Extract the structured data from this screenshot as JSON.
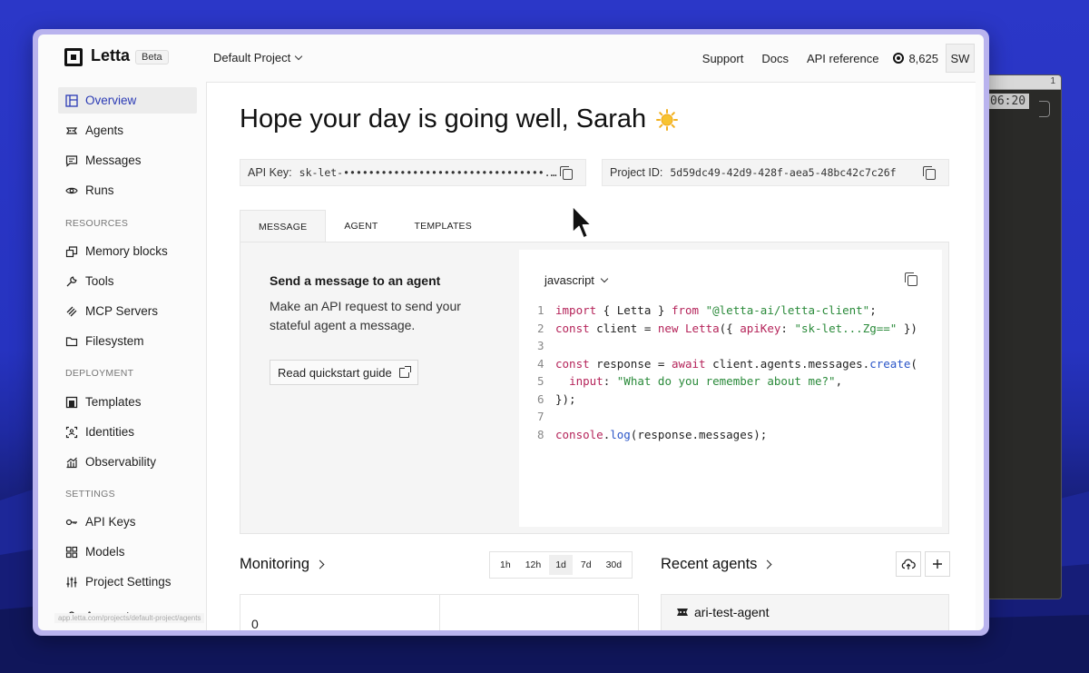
{
  "terminal": {
    "time": "06:20",
    "tab_num": "1"
  },
  "header": {
    "brand": "Letta",
    "badge": "Beta",
    "project": "Default Project",
    "links": [
      "Support",
      "Docs",
      "API reference"
    ],
    "credits": "8,625",
    "avatar": "SW"
  },
  "sidebar": {
    "items": [
      {
        "label": "Overview",
        "icon": "layout-icon",
        "active": true
      },
      {
        "label": "Agents",
        "icon": "agent-icon"
      },
      {
        "label": "Messages",
        "icon": "message-icon"
      },
      {
        "label": "Runs",
        "icon": "eye-icon"
      }
    ],
    "resources_label": "RESOURCES",
    "resources": [
      {
        "label": "Memory blocks",
        "icon": "blocks-icon"
      },
      {
        "label": "Tools",
        "icon": "wrench-icon"
      },
      {
        "label": "MCP Servers",
        "icon": "mcp-icon"
      },
      {
        "label": "Filesystem",
        "icon": "folder-icon"
      }
    ],
    "deployment_label": "DEPLOYMENT",
    "deployment": [
      {
        "label": "Templates",
        "icon": "template-icon"
      },
      {
        "label": "Identities",
        "icon": "identity-icon"
      },
      {
        "label": "Observability",
        "icon": "chart-icon"
      }
    ],
    "settings_label": "SETTINGS",
    "settings": [
      {
        "label": "API Keys",
        "icon": "key-icon"
      },
      {
        "label": "Models",
        "icon": "grid-icon"
      },
      {
        "label": "Project Settings",
        "icon": "sliders-icon"
      },
      {
        "label": "Account",
        "icon": "user-icon"
      }
    ],
    "status_url": "app.letta.com/projects/default-project/agents"
  },
  "main": {
    "greeting": "Hope your day is going well, Sarah",
    "api_key_label": "API Key:",
    "api_key_value": "sk-let-••••••••••••••••••••••••••••••••...",
    "project_id_label": "Project ID:",
    "project_id_value": "5d59dc49-42d9-428f-aea5-48bc42c7c26f",
    "tabs": [
      "MESSAGE",
      "AGENT",
      "TEMPLATES"
    ],
    "panel_title": "Send a message to an agent",
    "panel_desc": "Make an API request to send your stateful agent a message.",
    "quickstart_label": "Read quickstart guide",
    "code_lang": "javascript",
    "code_line_numbers": [
      "1",
      "2",
      "3",
      "4",
      "5",
      "6",
      "7",
      "8"
    ],
    "code_tokens": {
      "l1_import": "import",
      "l1_b": " { Letta } ",
      "l1_from": "from",
      "l1_sp": " ",
      "l1_str": "\"@letta-ai/letta-client\"",
      "l1_end": ";",
      "l2_const": "const",
      "l2_a": " client = ",
      "l2_new": "new",
      "l2_sp": " ",
      "l2_cls": "Letta",
      "l2_b": "({ ",
      "l2_key": "apiKey",
      "l2_c": ": ",
      "l2_str": "\"sk-let...Zg==\"",
      "l2_end": " })",
      "l4_const": "const",
      "l4_a": " response = ",
      "l4_await": "await",
      "l4_b": " client.agents.messages.",
      "l4_fn": "create",
      "l4_end": "(",
      "l5_indent": "  ",
      "l5_key": "input",
      "l5_c": ": ",
      "l5_str": "\"What do you remember about me?\"",
      "l5_end": ",",
      "l6": "});",
      "l8_fn": "console",
      "l8_dot": ".",
      "l8_log": "log",
      "l8_rest": "(response.messages);"
    },
    "monitoring_title": "Monitoring",
    "ranges": [
      "1h",
      "12h",
      "1d",
      "7d",
      "30d"
    ],
    "active_range": "1d",
    "monitoring_value": "0",
    "recent_agents_title": "Recent agents",
    "recent_agent_name": "ari-test-agent"
  },
  "colors": {
    "accent": "#2b3bb5",
    "window_border": "#b9b3ee",
    "desktop": "#2633c0"
  }
}
